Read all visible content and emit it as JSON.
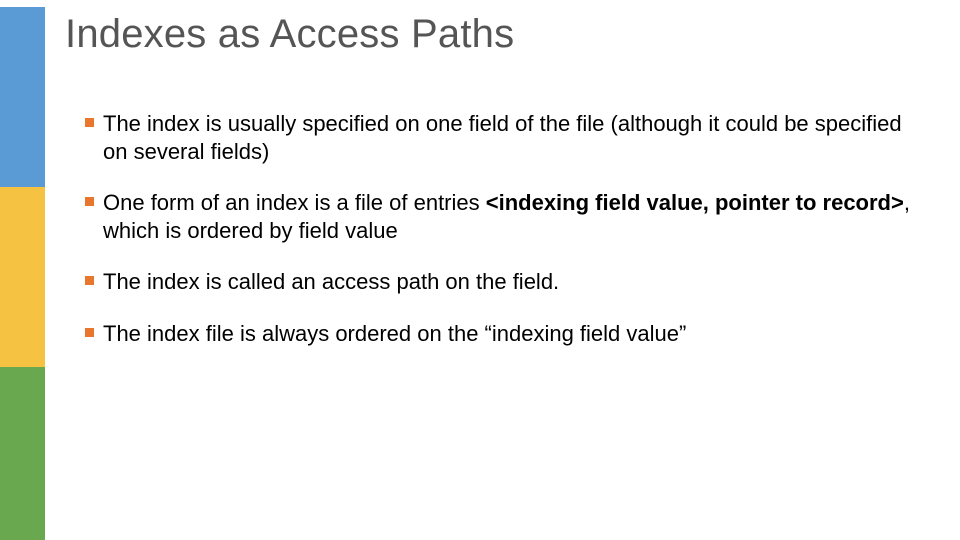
{
  "title": "Indexes as Access Paths",
  "bullets": {
    "b1": "The index is usually specified on one field of the file (although it could be specified on several fields)",
    "b2_pre": "One form of an index is a file of entries ",
    "b2_bold": "<indexing field value, pointer to record>",
    "b2_post": ", which is ordered by field value",
    "b3": "The index is called an access path on the field.",
    "b4": "The index file is always ordered on the “indexing field value”"
  },
  "colors": {
    "blue": "#5b9bd5",
    "yellow": "#f5c242",
    "green": "#6aa84f",
    "bullet": "#e8762d"
  }
}
